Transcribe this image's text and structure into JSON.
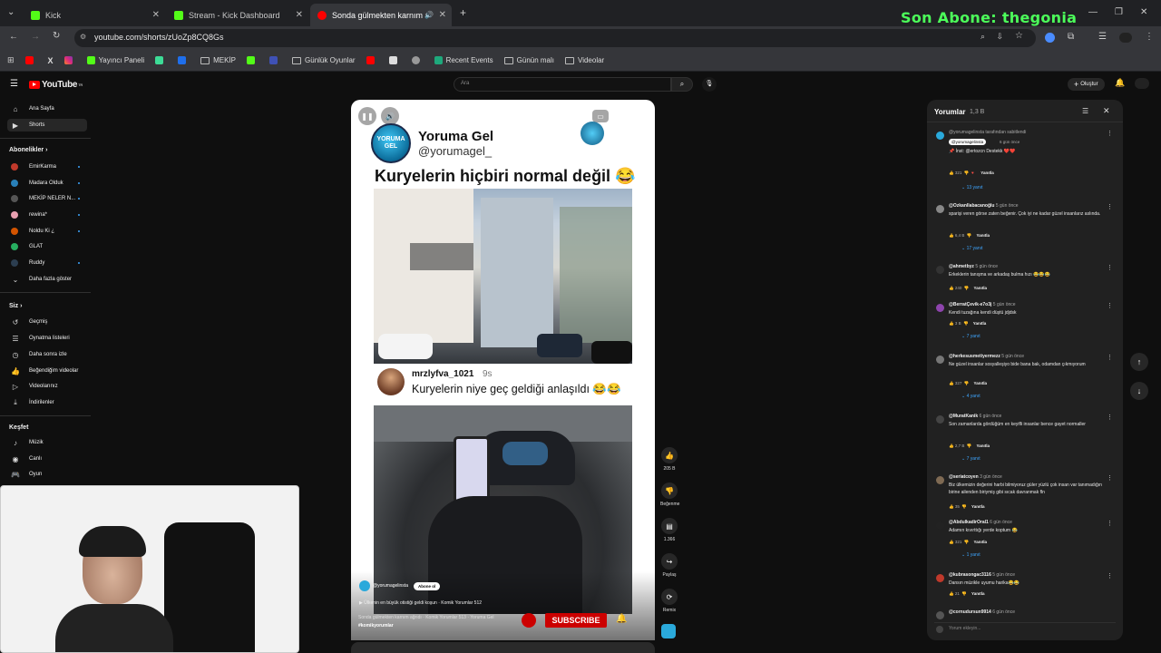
{
  "browser": {
    "tabs": [
      {
        "title": "Kick",
        "color": "#53fc18"
      },
      {
        "title": "Stream - Kick Dashboard",
        "color": "#53fc18"
      },
      {
        "title": "Sonda gülmekten karnım a",
        "color": "#ff0000"
      }
    ],
    "url": "youtube.com/shorts/zUoZp8CQ8Gs",
    "bookmarks": [
      {
        "label": "Yayıncı Paneli",
        "type": "icon",
        "color": "#53fc18"
      },
      {
        "label": "MEKİP",
        "type": "folder"
      },
      {
        "label": "Günlük Oyunlar",
        "type": "folder"
      },
      {
        "label": "Recent Events",
        "type": "icon",
        "color": "#1ea97c"
      },
      {
        "label": "Günün malı",
        "type": "folder"
      },
      {
        "label": "Videolar",
        "type": "folder"
      }
    ]
  },
  "overlay": {
    "last_sub": "Son Abone: thegonia"
  },
  "youtube": {
    "logo": "YouTube",
    "logo_suffix": "TR",
    "search_placeholder": "Ara",
    "create_label": "Oluştur",
    "sidebar": {
      "main": [
        {
          "label": "Ana Sayfa",
          "icon": "home-icon"
        },
        {
          "label": "Shorts",
          "icon": "shorts-icon"
        }
      ],
      "subs_header": "Abonelikler",
      "subs": [
        {
          "label": "EmirKarma",
          "color": "#c0392b"
        },
        {
          "label": "Madara Olduk",
          "color": "#2980b9"
        },
        {
          "label": "MEKİP NELER N...",
          "color": "#555"
        },
        {
          "label": "rewina*",
          "color": "#e8a0b0"
        },
        {
          "label": "Noldu Ki ¿",
          "color": "#d35400"
        },
        {
          "label": "GLAT",
          "color": "#27ae60"
        },
        {
          "label": "Ruddy",
          "color": "#2c3e50"
        }
      ],
      "show_more": "Daha fazla göster",
      "you_header": "Siz",
      "you": [
        {
          "label": "Geçmiş"
        },
        {
          "label": "Oynatma listeleri"
        },
        {
          "label": "Daha sonra izle"
        },
        {
          "label": "Beğendiğim videolar"
        },
        {
          "label": "Videolarınız"
        },
        {
          "label": "İndirilenler"
        }
      ],
      "explore_header": "Keşfet",
      "explore": [
        {
          "label": "Müzik"
        },
        {
          "label": "Canlı"
        },
        {
          "label": "Oyun"
        }
      ]
    }
  },
  "short": {
    "author_name": "Yoruma Gel",
    "author_handle": "@yorumagel_",
    "logo_text": "YORUMA GEL",
    "headline": "Kuryelerin hiçbiri normal değil 😂",
    "reply_user": "mrzlyfva_1021",
    "reply_time": "9s",
    "reply_text": "Kuryelerin niye geç geldiği anlaşıldı 😂😂",
    "channel": "@yorumagelinsta",
    "subscribe_small": "Abone ol",
    "playlist": "▶ Ülkenin en büyük otistiği geldi koşun · Komik Yorumlar 512",
    "desc": "Sonda gülmekten karnım ağrıdı · Komik Yorumlar 513 · Yoruma Gel",
    "hashtag": "#komikyorumlar",
    "subscribe_btn": "SUBSCRIBE"
  },
  "actions": {
    "likes": "205 B",
    "dislike": "Beğenme",
    "comments": "1.366",
    "share": "Paylaş",
    "remix": "Remix"
  },
  "comments_panel": {
    "title": "Yorumlar",
    "count": "1,3 B",
    "pinned_note": "@yorumagelinsta tarafından sabitlendi",
    "input_placeholder": "Yorum ekleyin...",
    "reply_label": "Yanıtla",
    "items": [
      {
        "user": "@yorumagelinsta",
        "time": "6 gün önce",
        "text": "📌 İnst: @ertozcn Destekk ❤️❤️",
        "likes": "321",
        "replies": "13 yanıt",
        "color": "#2aa9db"
      },
      {
        "user": "@Ozkanllabacanoğlu",
        "time": "5 gün önce",
        "text": "sparişi veren görse zaten beğenir. Çok iyi ne kadar güzel insanlarız aslında.",
        "likes": "6,4 B",
        "replies": "17 yanıt",
        "color": "#888"
      },
      {
        "user": "@ahmetbyz",
        "time": "5 gün önce",
        "text": "Erkeklerin tanışma ve arkadaş bulma hızı 😂😂😂",
        "likes": "240",
        "replies": "",
        "color": "#333"
      },
      {
        "user": "@BerratÇevik-e7o3j",
        "time": "5 gün önce",
        "text": "Kendi tuzağına kendi düştü jdjdsk",
        "likes": "3 B",
        "replies": "7 yanıt",
        "color": "#8e44ad"
      },
      {
        "user": "@herkesusmetiyermezz",
        "time": "5 gün önce",
        "text": "Ne güzel insanlar sosyalleşiyo bide bana bak, odamdan çıkmıyorum",
        "likes": "327",
        "replies": "4 yanıt",
        "color": "#777"
      },
      {
        "user": "@MuratKanik",
        "time": "6 gün önce",
        "text": "Son zamanlarda gördüğüm en keyifli insanlar bence gayet normaller",
        "likes": "2,7 B",
        "replies": "7 yanıt",
        "color": "#444"
      },
      {
        "user": "@seriatcoyen",
        "time": "3 gün önce",
        "text": "Biz ülkemizin değerini harbi bilmiyoruz güler yüzlü çok insan var tanımadığın birine ailenden biriymiş gibi sıcak davranmak fln",
        "likes": "35",
        "replies": "",
        "color": "#7f6a53"
      },
      {
        "user": "@AbdulkadirOral1",
        "time": "6 gün önce",
        "text": "Adamın kıvırttığı yerde koptum 😂",
        "likes": "321",
        "replies": "1 yanıt",
        "color": "#222"
      },
      {
        "user": "@kubrasongac3116",
        "time": "5 gün önce",
        "text": "Dansın müzikle uyumu harika😂😂",
        "likes": "21",
        "replies": "",
        "color": "#c0392b"
      },
      {
        "user": "@cornudursun9914",
        "time": "6 gün önce",
        "text": "",
        "likes": "",
        "replies": "",
        "color": "#555"
      }
    ]
  }
}
